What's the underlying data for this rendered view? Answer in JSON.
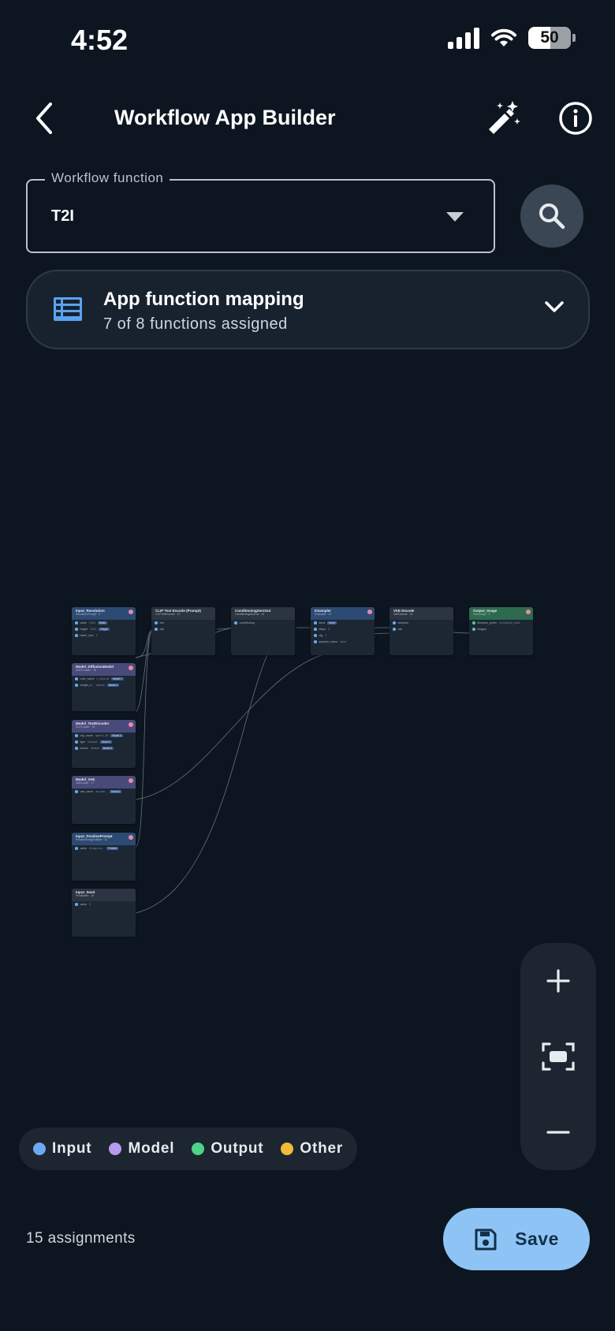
{
  "status_bar": {
    "time": "4:52",
    "battery": "50"
  },
  "header": {
    "title": "Workflow App Builder",
    "back_icon": "chevron-left-icon",
    "wand_icon": "magic-wand-icon",
    "info_icon": "info-icon"
  },
  "workflow_function": {
    "label": "Workflow function",
    "value": "T2I"
  },
  "mapping": {
    "title": "App function mapping",
    "subtitle": "7 of 8 functions assigned"
  },
  "graph": {
    "nodes": [
      {
        "id": "input-resolution",
        "title": "Input_Resolution",
        "sub": "ResolutionPrompt · 5",
        "kind": "input",
        "badge": true,
        "rows": [
          [
            "width",
            "1024",
            "Width"
          ],
          [
            "height",
            "1024",
            "Height"
          ],
          [
            "batch_size",
            "1",
            ""
          ]
        ]
      },
      {
        "id": "clip-encode",
        "title": "CLIP Text Encode (Prompt)",
        "sub": "CLIPTextEncode · 12",
        "kind": "other",
        "badge": false,
        "rows": [
          [
            "text",
            "",
            ""
          ],
          [
            "clip",
            "",
            ""
          ]
        ]
      },
      {
        "id": "conditioning-zero-out",
        "title": "ConditioningZeroOut",
        "sub": "ConditioningZeroOut · 14",
        "kind": "other",
        "badge": false,
        "rows": [
          [
            "conditioning",
            "",
            ""
          ]
        ]
      },
      {
        "id": "ksampler",
        "title": "KSampler",
        "sub": "KSampler · 13",
        "kind": "input",
        "badge": true,
        "rows": [
          [
            "seed",
            "",
            "Seed"
          ],
          [
            "steps",
            "9",
            ""
          ],
          [
            "cfg",
            "1",
            ""
          ],
          [
            "sampler_name",
            "euler",
            ""
          ]
        ]
      },
      {
        "id": "vae-decode",
        "title": "VAE Decode",
        "sub": "VAEDecode · 15",
        "kind": "other",
        "badge": false,
        "rows": [
          [
            "samples",
            "",
            ""
          ],
          [
            "vae",
            "",
            ""
          ]
        ]
      },
      {
        "id": "output-image",
        "title": "Output_Image",
        "sub": "SaveImage · 9",
        "kind": "output",
        "badge": true,
        "rows": [
          [
            "filename_prefix",
            "ComfyUI/z_turbo",
            ""
          ],
          [
            "images",
            "",
            ""
          ]
        ]
      },
      {
        "id": "model-diffusion",
        "title": "Model_DiffusionModel",
        "sub": "UNETLoader · 16",
        "kind": "model",
        "badge": true,
        "rows": [
          [
            "unet_name",
            "z_turbo.sf",
            "Model 1"
          ],
          [
            "weight_d...",
            "default",
            "Model 2"
          ]
        ]
      },
      {
        "id": "model-text-encoder",
        "title": "Model_TextEncoder",
        "sub": "CLIPLoader · 18",
        "kind": "model",
        "badge": true,
        "rows": [
          [
            "clip_name",
            "qwen3_4b",
            "Model 3"
          ],
          [
            "type",
            "lumina2",
            "Model 4"
          ],
          [
            "device",
            "default",
            "Model 5"
          ]
        ]
      },
      {
        "id": "model-vae",
        "title": "Model_VAE",
        "sub": "VAELoader · 17",
        "kind": "model",
        "badge": true,
        "rows": [
          [
            "vae_name",
            "ae.safe...",
            "Model 6"
          ]
        ]
      },
      {
        "id": "input-positive-prompt",
        "title": "Input_PositivePrompt",
        "sub": "PrimitiveStringMultiline · 10",
        "kind": "input",
        "badge": true,
        "rows": [
          [
            "value",
            "A high-res...",
            "Positive"
          ]
        ]
      },
      {
        "id": "input-seed",
        "title": "Input_Seed",
        "sub": "PrimitiveInt · 19",
        "kind": "other",
        "badge": false,
        "rows": [
          [
            "value",
            "0",
            ""
          ]
        ]
      }
    ]
  },
  "zoom": {
    "zoom_in_icon": "plus-icon",
    "fit_icon": "fit-screen-icon",
    "zoom_out_icon": "minus-icon"
  },
  "legend": [
    {
      "label": "Input",
      "color": "#6ea8f5"
    },
    {
      "label": "Model",
      "color": "#b49af0"
    },
    {
      "label": "Output",
      "color": "#4ed38a"
    },
    {
      "label": "Other",
      "color": "#f2b93a"
    }
  ],
  "footer": {
    "assignments": "15 assignments",
    "save_label": "Save",
    "save_icon": "floppy-disk-icon"
  },
  "colors": {
    "background": "#0d1620",
    "accent": "#8ec4f5"
  }
}
